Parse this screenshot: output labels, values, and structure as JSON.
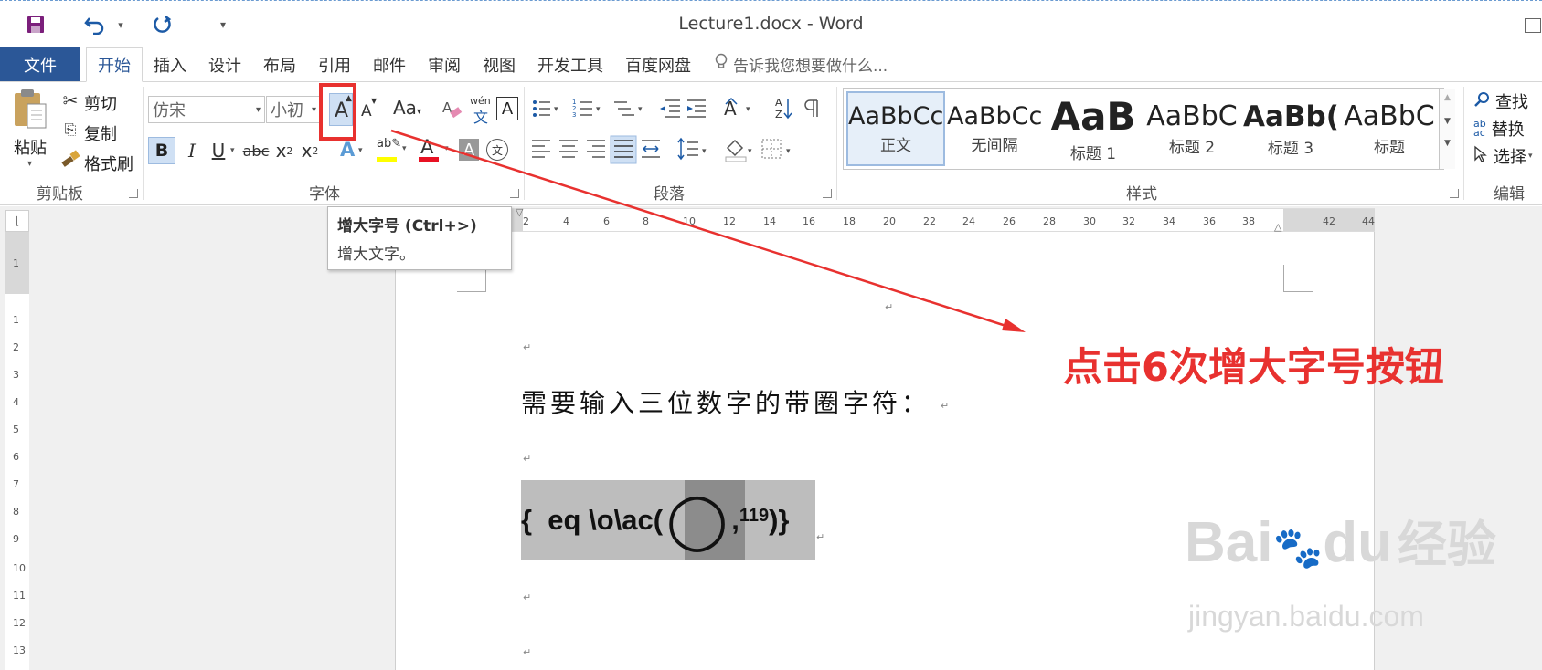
{
  "window": {
    "title": "Lecture1.docx - Word"
  },
  "quick_access": {
    "save_icon": "save-icon",
    "undo_icon": "undo-icon",
    "redo_icon": "redo-icon",
    "customize_icon": "customize-icon"
  },
  "tabs": {
    "file": "文件",
    "home": "开始",
    "insert": "插入",
    "design": "设计",
    "layout": "布局",
    "references": "引用",
    "mailings": "邮件",
    "review": "审阅",
    "view": "视图",
    "developer": "开发工具",
    "baidu": "百度网盘",
    "tellme": "告诉我您想要做什么..."
  },
  "clipboard": {
    "paste": "粘贴",
    "cut": "剪切",
    "copy": "复制",
    "format_painter": "格式刷",
    "label": "剪贴板"
  },
  "font": {
    "name": "仿宋",
    "size": "小初",
    "label": "字体",
    "aa_label": "Aa",
    "bold": "B",
    "italic": "I",
    "underline": "U",
    "strike": "abc",
    "subscript": "x",
    "superscript": "x",
    "subscript_mark": "2",
    "superscript_mark": "2",
    "grow": "A",
    "shrink": "A",
    "wen": "wén",
    "wen_char": "文"
  },
  "paragraph": {
    "label": "段落"
  },
  "styles": {
    "label": "样式",
    "items": [
      {
        "sample": "AaBbCcI",
        "name": "正文"
      },
      {
        "sample": "AaBbCcI",
        "name": "无间隔"
      },
      {
        "sample": "AaB",
        "name": "标题 1"
      },
      {
        "sample": "AaBbC",
        "name": "标题 2"
      },
      {
        "sample": "AaBb(",
        "name": "标题 3"
      },
      {
        "sample": "AaBbC",
        "name": "标题"
      }
    ]
  },
  "editing": {
    "find": "查找",
    "replace": "替换",
    "select": "选择",
    "label": "编辑"
  },
  "tooltip": {
    "title": "增大字号 (Ctrl+>)",
    "desc": "增大文字。"
  },
  "ruler": {
    "h": [
      "2",
      "4",
      "6",
      "8",
      "10",
      "12",
      "14",
      "16",
      "18",
      "20",
      "22",
      "24",
      "26",
      "28",
      "30",
      "32",
      "34",
      "36",
      "38",
      "42",
      "44"
    ],
    "v": [
      "1",
      "1",
      "2",
      "3",
      "4",
      "5",
      "6",
      "7",
      "8",
      "9",
      "10",
      "11",
      "12",
      "13"
    ]
  },
  "document": {
    "heading": "需要输入三位数字的带圈字符：",
    "field_prefix": "{  eq \\o\\ac(",
    "field_circle": "◯",
    "field_sep": ",",
    "field_num": "119",
    "field_suffix": ")}"
  },
  "annotation": {
    "text": "点击6次增大字号按钮"
  },
  "watermark": {
    "main": "Bai",
    "du": "du",
    "cn": "经验",
    "url": "jingyan.baidu.com"
  },
  "colors": {
    "accent": "#2b5797",
    "annotation": "#e8312f",
    "highlight_yellow": "#ffff00",
    "font_red": "#e81123"
  }
}
